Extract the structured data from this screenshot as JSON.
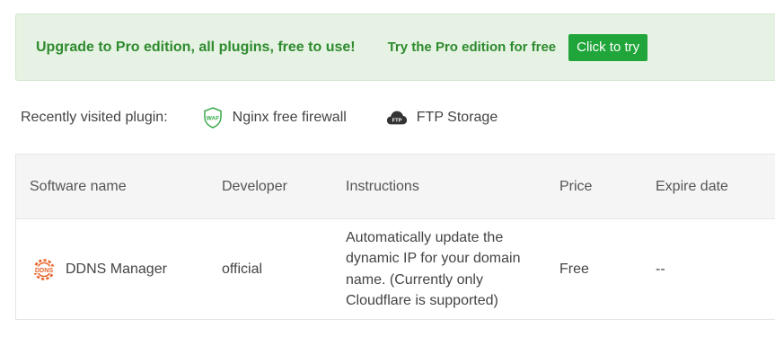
{
  "promo": {
    "title": "Upgrade to Pro edition, all plugins, free to use!",
    "try_text": "Try the Pro edition for free",
    "button_label": "Click to try"
  },
  "recent": {
    "label": "Recently visited plugin:",
    "plugins": [
      {
        "name": "Nginx free firewall",
        "icon": "waf-shield-icon",
        "badge": "WAF"
      },
      {
        "name": "FTP Storage",
        "icon": "ftp-cloud-icon",
        "badge": "FTP"
      }
    ]
  },
  "table": {
    "headers": {
      "name": "Software name",
      "developer": "Developer",
      "instructions": "Instructions",
      "price": "Price",
      "expire": "Expire date"
    },
    "rows": [
      {
        "name": "DDNS Manager",
        "icon_text": "DDNS",
        "developer": "official",
        "instructions": "Automatically update the dynamic IP for your domain name. (Currently only Cloudflare is supported)",
        "price": "Free",
        "expire": "--"
      }
    ]
  },
  "colors": {
    "accent": "#20a53a",
    "promo_text": "#2e8b2e",
    "promo_bg": "#e6f2e3",
    "ddns_orange": "#e8652b"
  }
}
